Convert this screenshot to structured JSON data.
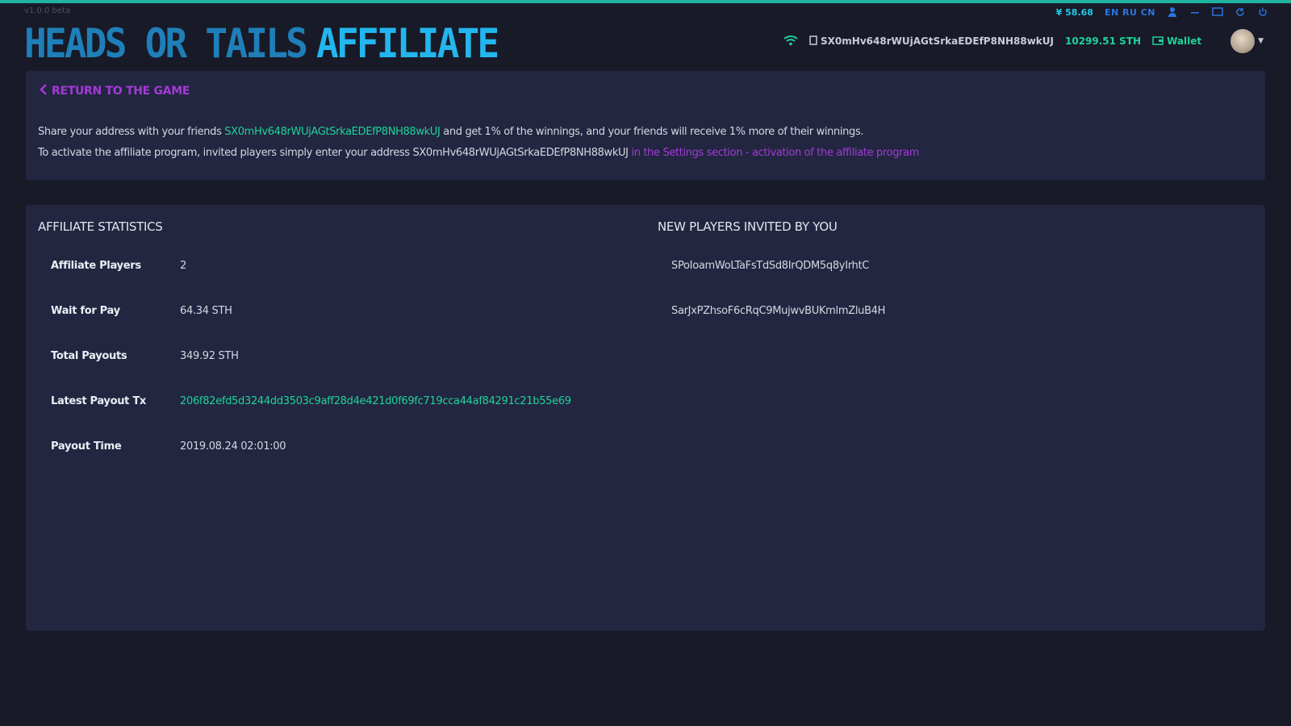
{
  "app": {
    "version": "v1.0.0 beta",
    "logo_part1": "HEADS OR TAILS",
    "logo_part2": "AFFILIATE"
  },
  "titlebar": {
    "price": "¥ 58.68",
    "languages": "EN RU CN"
  },
  "header": {
    "address": "SX0mHv648rWUjAGtSrkaEDEfP8NH88wkUJ",
    "balance": "10299.51 STH",
    "wallet_label": "Wallet"
  },
  "info": {
    "return_label": "RETURN TO THE GAME",
    "line1_prefix": "Share your address with your friends ",
    "line1_address": "SX0mHv648rWUjAGtSrkaEDEfP8NH88wkUJ",
    "line1_suffix": " and get 1% of the winnings, and your friends will receive 1% more of their winnings.",
    "line2_prefix": "To activate the affiliate program, invited players simply enter your address SX0mHv648rWUjAGtSrkaEDEfP8NH88wkUJ ",
    "line2_link": "in the Settings section - activation of the affiliate program"
  },
  "stats": {
    "title": "AFFILIATE STATISTICS",
    "rows": [
      {
        "label": "Affiliate Players",
        "value": "2"
      },
      {
        "label": "Wait for Pay",
        "value": "64.34 STH"
      },
      {
        "label": "Total Payouts",
        "value": "349.92 STH"
      },
      {
        "label": "Latest Payout Tx",
        "value": "206f82efd5d3244dd3503c9aff28d4e421d0f69fc719cca44af84291c21b55e69"
      },
      {
        "label": "Payout Time",
        "value": "2019.08.24 02:01:00"
      }
    ]
  },
  "invited": {
    "title": "NEW PLAYERS INVITED BY YOU",
    "players": [
      "SPoIoamWoLTaFsTdSd8IrQDM5q8yIrhtC",
      "SarJxPZhsoF6cRqC9MujwvBUKmlmZluB4H"
    ]
  },
  "colors": {
    "accent_green": "#1fd39a",
    "accent_purple": "#a43ad8",
    "accent_blue": "#23b6ee",
    "panel": "#222640",
    "background": "#181a28"
  }
}
